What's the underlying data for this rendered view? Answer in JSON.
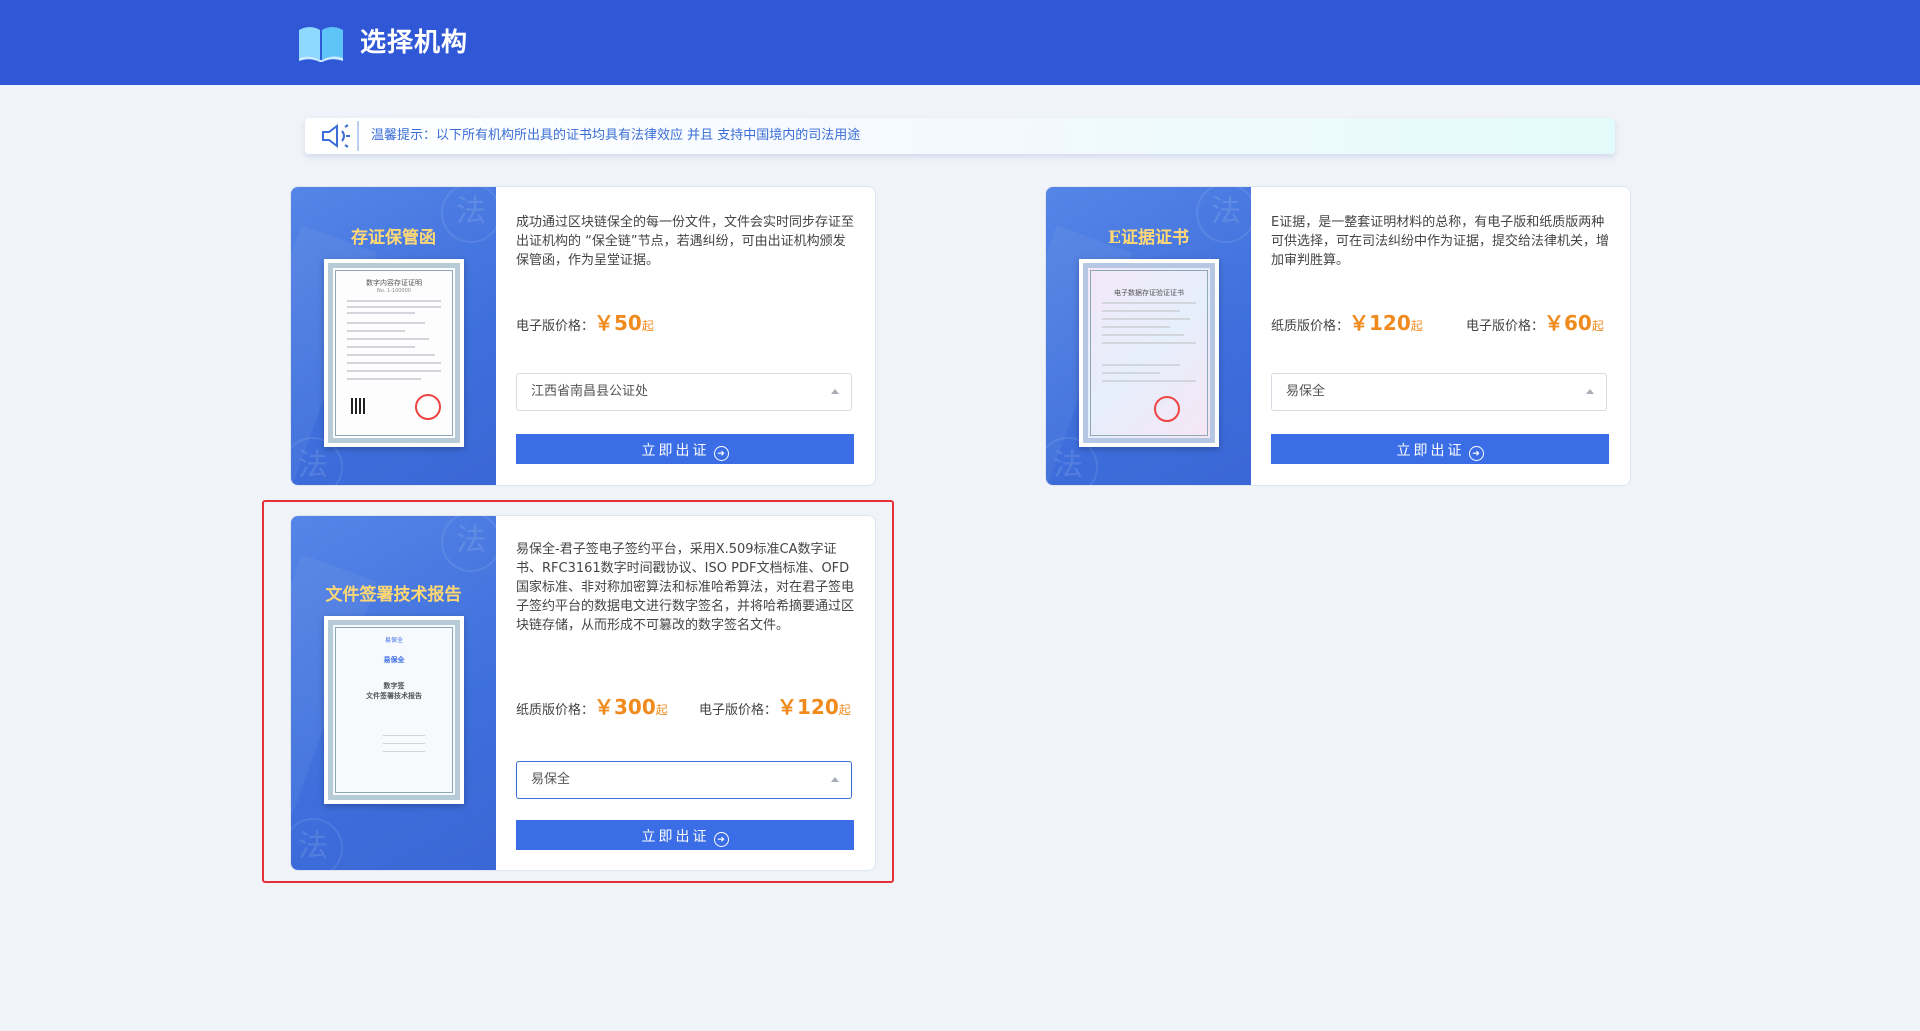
{
  "header": {
    "title": "选择机构",
    "logo_icon": "open-book-icon",
    "bg_color": "#3058d6"
  },
  "notice": {
    "icon": "speaker-icon",
    "text": "温馨提示：以下所有机构所出具的证书均具有法律效应 并且 支持中国境内的司法用途"
  },
  "cards": [
    {
      "title": "存证保管函",
      "description": "成功通过区块链保全的每一份文件，文件会实时同步存证至出证机构的 “保全链”节点，若遇纠纷，可由出证机构颁发保管函，作为呈堂证据。",
      "prices": [
        {
          "label": "电子版价格：",
          "symbol": "￥",
          "value": "50",
          "suffix": "起"
        }
      ],
      "select_value": "江西省南昌县公证处",
      "button_label": "立即出证",
      "certificate": {
        "heading": "数字内容存证证明",
        "subheading": "No. 1-100000"
      }
    },
    {
      "title": "E证据证书",
      "description": "E证据，是一整套证明材料的总称，有电子版和纸质版两种可供选择，可在司法纠纷中作为证据，提交给法律机关，增加审判胜算。",
      "prices": [
        {
          "label": "纸质版价格：",
          "symbol": "￥",
          "value": "120",
          "suffix": "起"
        },
        {
          "label": "电子版价格：",
          "symbol": "￥",
          "value": "60",
          "suffix": "起"
        }
      ],
      "select_value": "易保全",
      "button_label": "立即出证",
      "certificate": {
        "heading": "电子数据存证验证证书"
      }
    },
    {
      "title": "文件签署技术报告",
      "description": "易保全-君子签电子签约平台，采用X.509标准CA数字证书、RFC3161数字时间戳协议、ISO PDF文档标准、OFD国家标准、非对称加密算法和标准哈希算法，对在君子签电子签约平台的数据电文进行数字签名，并将哈希摘要通过区块链存储，从而形成不可篡改的数字签名文件。",
      "prices": [
        {
          "label": "纸质版价格：",
          "symbol": "￥",
          "value": "300",
          "suffix": "起"
        },
        {
          "label": "电子版价格：",
          "symbol": "￥",
          "value": "120",
          "suffix": "起"
        }
      ],
      "select_value": "易保全",
      "button_label": "立即出证",
      "certificate": {
        "brand": "易保全",
        "heading": "数字签",
        "subheading": "文件签署技术报告"
      }
    }
  ],
  "colors": {
    "accent": "#3a6de6",
    "price": "#f08a1c",
    "card_title": "#ffd873",
    "highlight": "#e5303a"
  },
  "watermark_char": "法"
}
